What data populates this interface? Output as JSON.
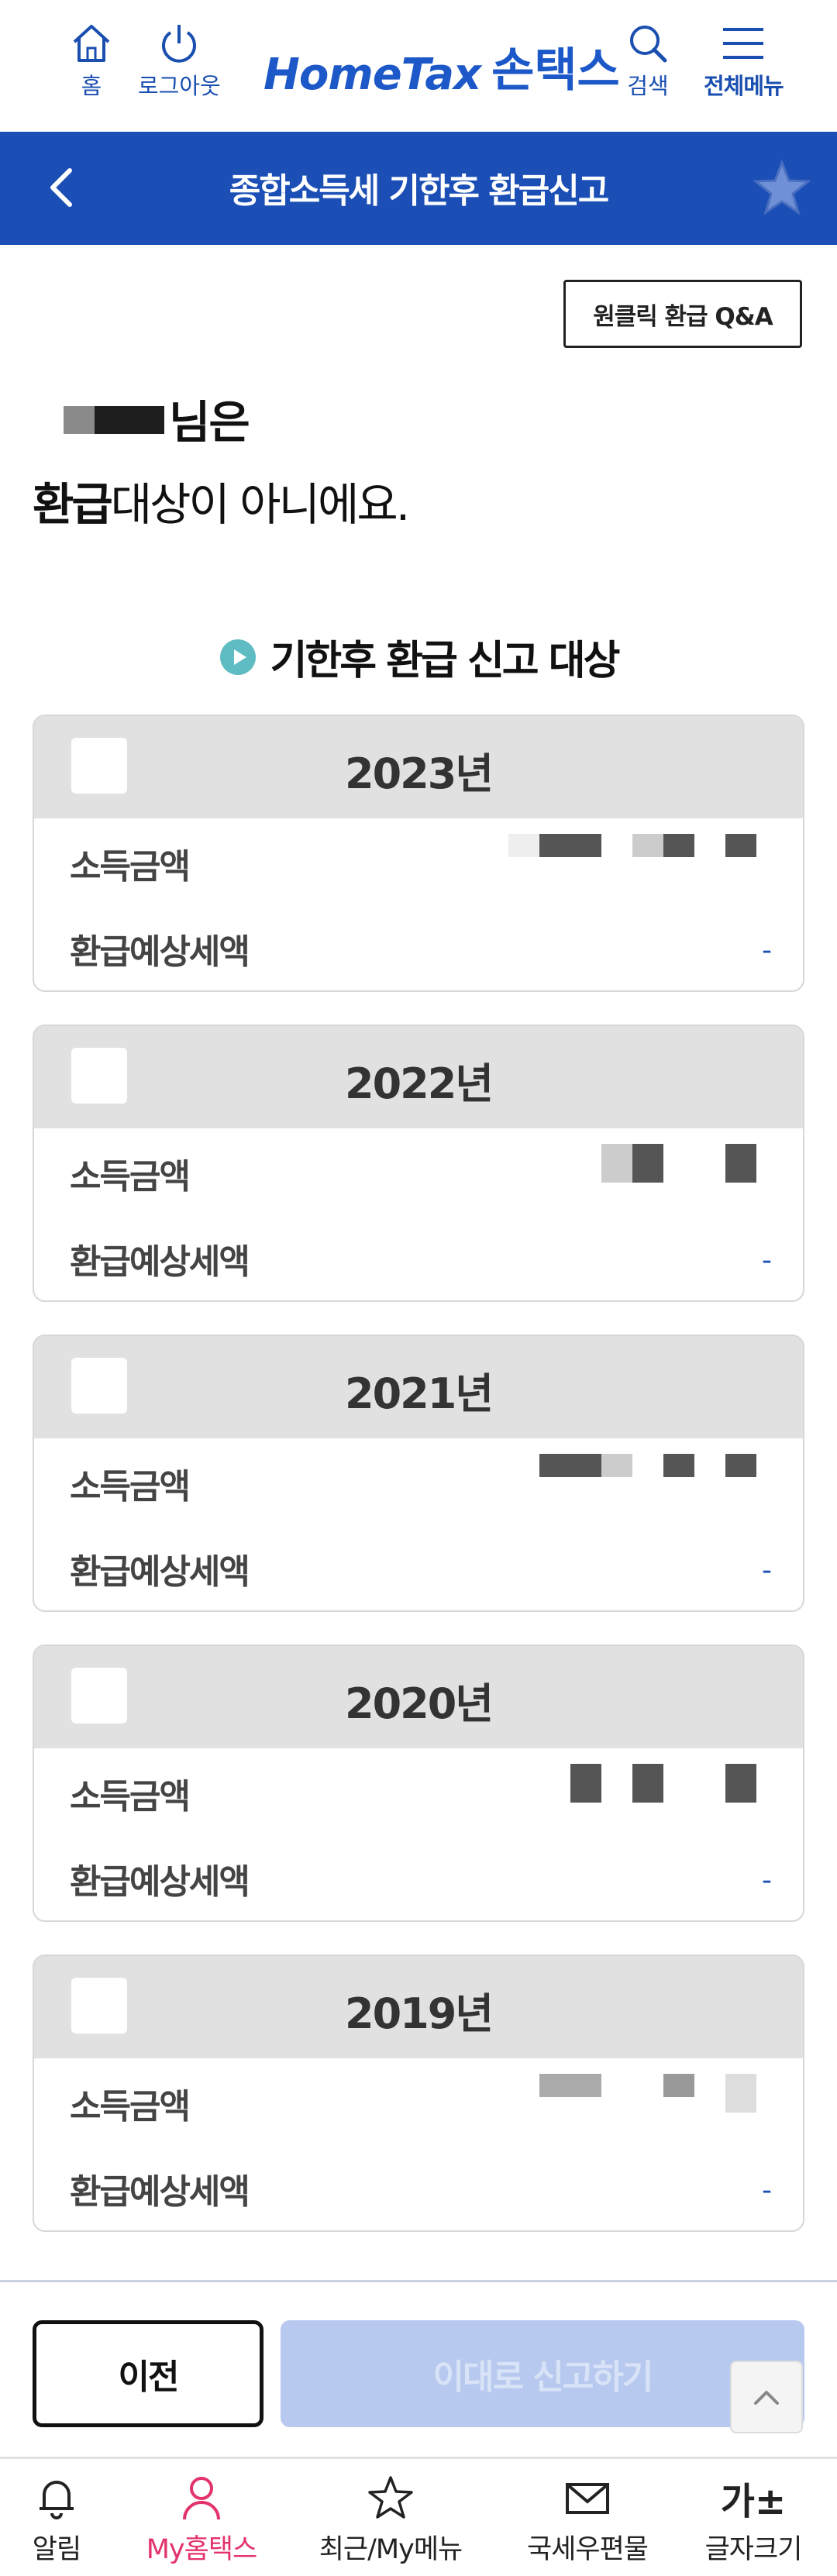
{
  "header": {
    "home_label": "홈",
    "logout_label": "로그아웃",
    "logo_en": "HomeTax",
    "logo_ko": "손택스",
    "search_label": "검색",
    "menu_label": "전체메뉴"
  },
  "title_bar": {
    "title": "종합소득세 기한후 환급신고"
  },
  "qa_button": "원클릭 환급 Q&A",
  "greeting_suffix": "님은",
  "result": {
    "strong": "환급",
    "rest": "대상이 아니에요."
  },
  "section_title": "기한후 환급 신고 대상",
  "labels": {
    "income": "소득금액",
    "refund": "환급예상세액"
  },
  "years": [
    {
      "year": "2023년",
      "refund_value": "-"
    },
    {
      "year": "2022년",
      "refund_value": "-"
    },
    {
      "year": "2021년",
      "refund_value": "-"
    },
    {
      "year": "2020년",
      "refund_value": "-"
    },
    {
      "year": "2019년",
      "refund_value": "-"
    }
  ],
  "buttons": {
    "prev": "이전",
    "submit": "이대로 신고하기"
  },
  "bottom_nav": {
    "alarm": "알림",
    "my": "My홈택스",
    "recent": "최근/My메뉴",
    "mail": "국세우편물",
    "font_glyph": "가±",
    "font": "글자크기"
  },
  "colors": {
    "brand_blue": "#1b4fb6",
    "active_pink": "#e3336b",
    "disabled_btn": "#b8c9ef"
  }
}
